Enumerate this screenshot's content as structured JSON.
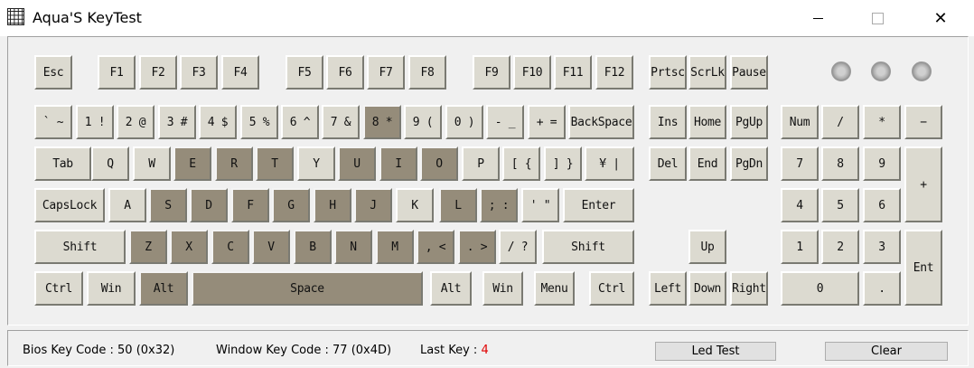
{
  "window": {
    "title": "Aqua'S KeyTest"
  },
  "titlebar_buttons": {
    "minimize": "–",
    "maximize": "☐",
    "close": "✕"
  },
  "status": {
    "bios_key_code": "Bios Key Code : 50 (0x32)",
    "window_key_code": "Window Key Code : 77 (0x4D)",
    "last_key_label": "Last Key : ",
    "last_key_value": "4"
  },
  "buttons": {
    "led_test": "Led Test",
    "clear": "Clear"
  },
  "keys": {
    "esc": "Esc",
    "f1": "F1",
    "f2": "F2",
    "f3": "F3",
    "f4": "F4",
    "f5": "F5",
    "f6": "F6",
    "f7": "F7",
    "f8": "F8",
    "f9": "F9",
    "f10": "F10",
    "f11": "F11",
    "f12": "F12",
    "prtsc": "Prtsc",
    "scrlk": "ScrLk",
    "pause": "Pause",
    "backtick": "` ~",
    "d1": "1 !",
    "d2": "2 @",
    "d3": "3 #",
    "d4": "4 $",
    "d5": "5 %",
    "d6": "6 ^",
    "d7": "7 &",
    "d8": "8 *",
    "d9": "9 (",
    "d0": "0 )",
    "minus": "- _",
    "equals": "+ =",
    "backspace": "BackSpace",
    "ins": "Ins",
    "home": "Home",
    "pgup": "PgUp",
    "num": "Num",
    "np_div": "/",
    "np_mul": "*",
    "np_sub": "−",
    "tab": "Tab",
    "q": "Q",
    "w": "W",
    "e": "E",
    "r": "R",
    "t": "T",
    "y": "Y",
    "u": "U",
    "i": "I",
    "o": "O",
    "p": "P",
    "lbracket": "[ {",
    "rbracket": "] }",
    "yen": "¥ |",
    "del": "Del",
    "end": "End",
    "pgdn": "PgDn",
    "np7": "7",
    "np8": "8",
    "np9": "9",
    "np_add": "+",
    "capslock": "CapsLock",
    "a": "A",
    "s": "S",
    "d": "D",
    "f": "F",
    "g": "G",
    "h": "H",
    "j": "J",
    "k": "K",
    "l": "L",
    "semicolon": "; :",
    "quote": "' \"",
    "enter": "Enter",
    "np4": "4",
    "np5": "5",
    "np6": "6",
    "lshift": "Shift",
    "z": "Z",
    "x": "X",
    "c": "C",
    "v": "V",
    "b": "B",
    "n": "N",
    "m": "M",
    "comma": ", <",
    "period": ". >",
    "slash": "/ ?",
    "rshift": "Shift",
    "up": "Up",
    "np1": "1",
    "np2": "2",
    "np3": "3",
    "np_enter": "Ent",
    "lctrl": "Ctrl",
    "lwin": "Win",
    "lalt": "Alt",
    "space": "Space",
    "ralt": "Alt",
    "rwin": "Win",
    "menu": "Menu",
    "rctrl": "Ctrl",
    "left": "Left",
    "down": "Down",
    "right": "Right",
    "np0": "0",
    "np_dot": "."
  },
  "pressed_keys": [
    "d8",
    "e",
    "r",
    "t",
    "u",
    "i",
    "o",
    "s",
    "d",
    "f",
    "g",
    "h",
    "j",
    "l",
    "semicolon",
    "z",
    "x",
    "c",
    "v",
    "b",
    "n",
    "m",
    "comma",
    "period",
    "lalt",
    "space"
  ],
  "colors": {
    "key_normal": "#dcdad0",
    "key_pressed": "#958c7a",
    "last_key_value": "#e00000"
  }
}
